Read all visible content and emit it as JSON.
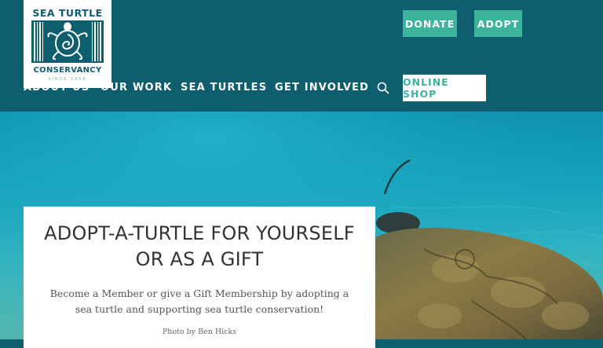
{
  "logo": {
    "top_text": "SEA TURTLE",
    "bottom_text": "CONSERVANCY",
    "since_text": "SINCE 1959",
    "icon": "turtle-logo-icon"
  },
  "header": {
    "donate_label": "DONATE",
    "adopt_label": "ADOPT"
  },
  "nav": {
    "items": [
      {
        "label": "ABOUT US"
      },
      {
        "label": "OUR WORK"
      },
      {
        "label": "SEA TURTLES"
      },
      {
        "label": "GET INVOLVED"
      }
    ],
    "search_icon": "search-icon",
    "shop_label": "ONLINE SHOP"
  },
  "hero": {
    "title_line1": "ADOPT-A-TURTLE FOR YOURSELF",
    "title_line2": "OR AS A GIFT",
    "description": "Become a Member or give a Gift Membership by adopting a sea turtle and supporting sea turtle conservation!",
    "photo_credit": "Photo by Ben Hicks"
  },
  "colors": {
    "header_bg": "#0e5e6f",
    "accent": "#3cb49b",
    "water": "#16a3bd"
  }
}
